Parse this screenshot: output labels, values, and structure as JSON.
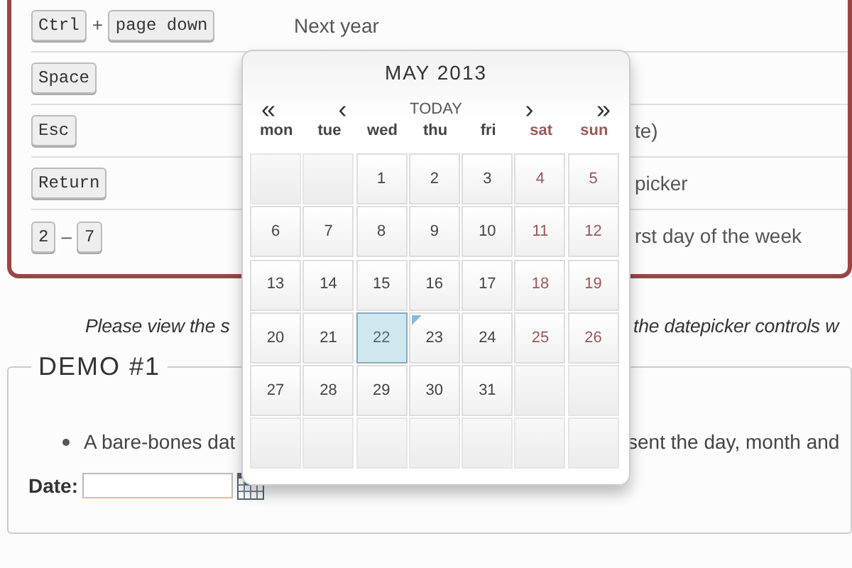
{
  "shortcuts": [
    {
      "keys": [
        {
          "kind": "key",
          "text": "Ctrl"
        },
        {
          "kind": "sep",
          "text": "+"
        },
        {
          "kind": "key",
          "text": "page down"
        }
      ],
      "description": "Next year",
      "kind": "full"
    },
    {
      "keys": [
        {
          "kind": "key",
          "text": "Space"
        }
      ]
    },
    {
      "keys": [
        {
          "kind": "key",
          "text": "Esc"
        }
      ],
      "description": "te)",
      "kind": "partial"
    },
    {
      "keys": [
        {
          "kind": "key",
          "text": "Return"
        }
      ],
      "description": "picker",
      "kind": "partial"
    },
    {
      "keys": [
        {
          "kind": "key",
          "text": "2"
        },
        {
          "kind": "sep",
          "text": "–"
        },
        {
          "kind": "key",
          "text": "7"
        }
      ],
      "description": "rst day of the week",
      "kind": "partial"
    }
  ],
  "note": {
    "left": "Please view the s",
    "right": "the datepicker controls w"
  },
  "demo": {
    "legend": "DEMO #1",
    "bullet_left": "A bare-bones dat",
    "bullet_right": "sent the day, month and",
    "date_label": "Date:"
  },
  "calendar": {
    "title": "MAY 2013",
    "nav": [
      "«",
      "‹",
      "TODAY",
      "›",
      "»"
    ],
    "weekdays": [
      {
        "label": "mon",
        "weekend": false
      },
      {
        "label": "tue",
        "weekend": false
      },
      {
        "label": "wed",
        "weekend": false
      },
      {
        "label": "thu",
        "weekend": false
      },
      {
        "label": "fri",
        "weekend": false
      },
      {
        "label": "sat",
        "weekend": true
      },
      {
        "label": "sun",
        "weekend": true
      }
    ],
    "weeks": [
      [
        {
          "kind": "empty"
        },
        {
          "kind": "empty"
        },
        {
          "kind": "day",
          "day": "1",
          "selected": false,
          "today": false
        },
        {
          "kind": "day",
          "day": "2",
          "selected": false,
          "today": false
        },
        {
          "kind": "day",
          "day": "3",
          "selected": false,
          "today": false
        },
        {
          "kind": "day",
          "day": "4",
          "selected": false,
          "today": false
        },
        {
          "kind": "day",
          "day": "5",
          "selected": false,
          "today": false
        }
      ],
      [
        {
          "kind": "day",
          "day": "6",
          "selected": false,
          "today": false
        },
        {
          "kind": "day",
          "day": "7",
          "selected": false,
          "today": false
        },
        {
          "kind": "day",
          "day": "8",
          "selected": false,
          "today": false
        },
        {
          "kind": "day",
          "day": "9",
          "selected": false,
          "today": false
        },
        {
          "kind": "day",
          "day": "10",
          "selected": false,
          "today": false
        },
        {
          "kind": "day",
          "day": "11",
          "selected": false,
          "today": false
        },
        {
          "kind": "day",
          "day": "12",
          "selected": false,
          "today": false
        }
      ],
      [
        {
          "kind": "day",
          "day": "13",
          "selected": false,
          "today": false
        },
        {
          "kind": "day",
          "day": "14",
          "selected": false,
          "today": false
        },
        {
          "kind": "day",
          "day": "15",
          "selected": false,
          "today": false
        },
        {
          "kind": "day",
          "day": "16",
          "selected": false,
          "today": false
        },
        {
          "kind": "day",
          "day": "17",
          "selected": false,
          "today": false
        },
        {
          "kind": "day",
          "day": "18",
          "selected": false,
          "today": false
        },
        {
          "kind": "day",
          "day": "19",
          "selected": false,
          "today": false
        }
      ],
      [
        {
          "kind": "day",
          "day": "20",
          "selected": false,
          "today": false
        },
        {
          "kind": "day",
          "day": "21",
          "selected": false,
          "today": false
        },
        {
          "kind": "day",
          "day": "22",
          "selected": true,
          "today": false
        },
        {
          "kind": "day",
          "day": "23",
          "selected": false,
          "today": true
        },
        {
          "kind": "day",
          "day": "24",
          "selected": false,
          "today": false
        },
        {
          "kind": "day",
          "day": "25",
          "selected": false,
          "today": false
        },
        {
          "kind": "day",
          "day": "26",
          "selected": false,
          "today": false
        }
      ],
      [
        {
          "kind": "day",
          "day": "27",
          "selected": false,
          "today": false
        },
        {
          "kind": "day",
          "day": "28",
          "selected": false,
          "today": false
        },
        {
          "kind": "day",
          "day": "29",
          "selected": false,
          "today": false
        },
        {
          "kind": "day",
          "day": "30",
          "selected": false,
          "today": false
        },
        {
          "kind": "day",
          "day": "31",
          "selected": false,
          "today": false
        },
        {
          "kind": "empty"
        },
        {
          "kind": "empty"
        }
      ],
      [
        {
          "kind": "empty"
        },
        {
          "kind": "empty"
        },
        {
          "kind": "empty"
        },
        {
          "kind": "empty"
        },
        {
          "kind": "empty"
        },
        {
          "kind": "empty"
        },
        {
          "kind": "empty"
        }
      ]
    ]
  }
}
